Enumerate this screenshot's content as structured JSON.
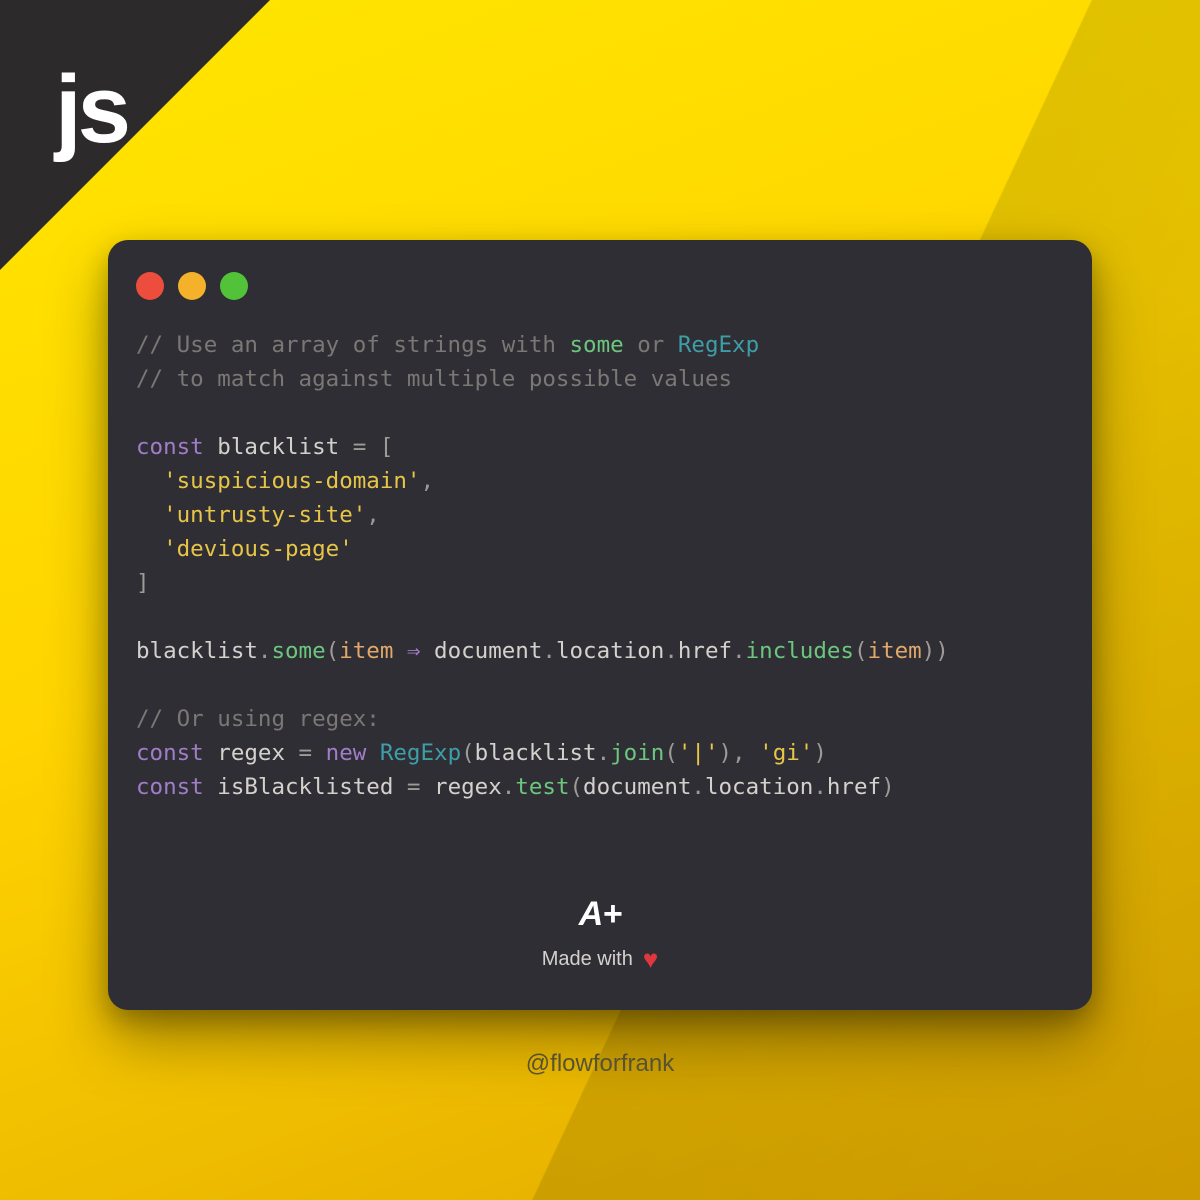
{
  "corner_label": "js",
  "traffic_lights": {
    "red": "#ec4d3c",
    "yellow": "#f5b12a",
    "green": "#52c238"
  },
  "code": {
    "comment1": "// Use an array of strings with ",
    "comment1_highlight1": "some",
    "comment1_mid": " or ",
    "comment1_highlight2": "RegExp",
    "comment2": "// to match against multiple possible values",
    "const_kw": "const",
    "blacklist_name": "blacklist",
    "equals": " = ",
    "bracket_open": "[",
    "item1": "'suspicious-domain'",
    "item2": "'untrusty-site'",
    "item3": "'devious-page'",
    "bracket_close": "]",
    "some_call_obj": "blacklist",
    "some_method": "some",
    "some_param": "item",
    "arrow": " ⇒ ",
    "document": "document",
    "location": "location",
    "href": "href",
    "includes": "includes",
    "comment3": "// Or using regex:",
    "regex_var": "regex",
    "new_kw": "new",
    "regexp_class": "RegExp",
    "join_method": "join",
    "pipe_str": "'|'",
    "gi_str": "'gi'",
    "isbl_var": "isBlacklisted",
    "test_method": "test"
  },
  "badge": {
    "logo": "A+",
    "made_with": "Made with",
    "heart": "♥"
  },
  "handle": "@flowforfrank"
}
